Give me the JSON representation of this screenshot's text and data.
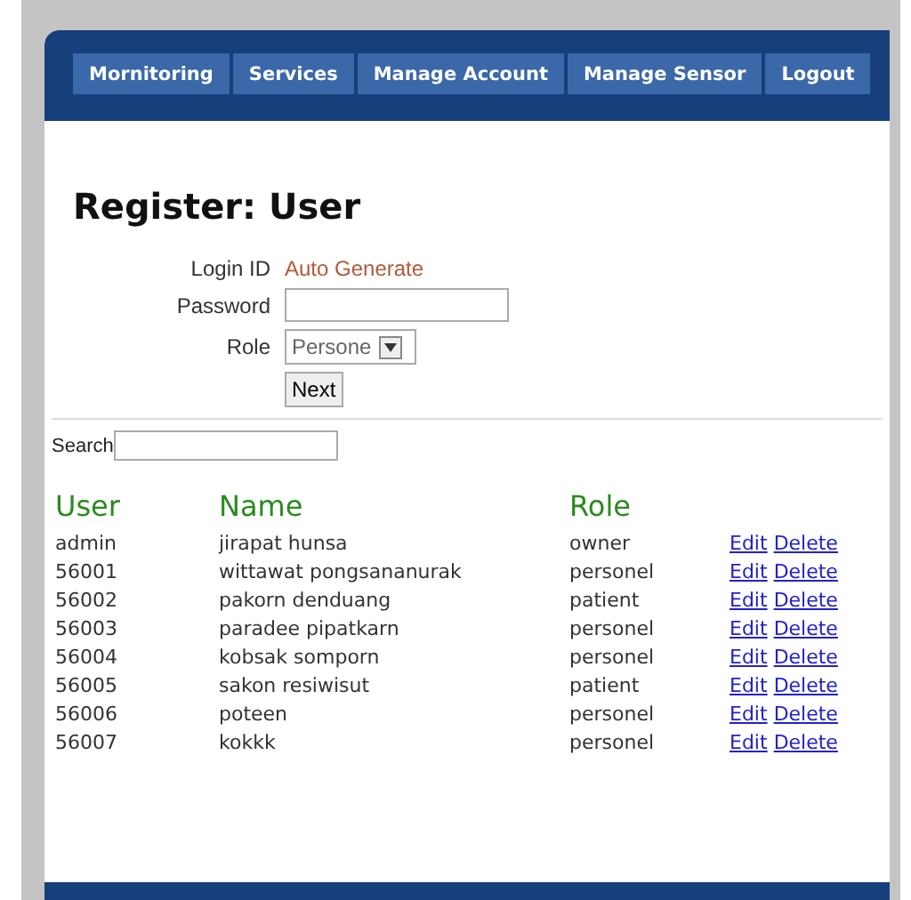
{
  "nav": [
    {
      "label": "Mornitoring"
    },
    {
      "label": "Services"
    },
    {
      "label": "Manage Account"
    },
    {
      "label": "Manage Sensor"
    },
    {
      "label": "Logout"
    }
  ],
  "heading": "Register: User",
  "form": {
    "login_label": "Login ID",
    "login_value": "Auto Generate",
    "password_label": "Password",
    "role_label": "Role",
    "role_value": "Persone",
    "next": "Next"
  },
  "search": {
    "label": "Search"
  },
  "table": {
    "columns": [
      "User",
      "Name",
      "Role"
    ],
    "rows": [
      {
        "user": "admin",
        "name": "jirapat hunsa",
        "role": "owner",
        "edit": "Edit",
        "delete": "Delete"
      },
      {
        "user": "56001",
        "name": "wittawat pongsananurak",
        "role": "personel",
        "edit": "Edit",
        "delete": "Delete"
      },
      {
        "user": "56002",
        "name": "pakorn denduang",
        "role": "patient",
        "edit": "Edit",
        "delete": "Delete"
      },
      {
        "user": "56003",
        "name": "paradee pipatkarn",
        "role": "personel",
        "edit": "Edit",
        "delete": "Delete"
      },
      {
        "user": "56004",
        "name": "kobsak somporn",
        "role": "personel",
        "edit": "Edit",
        "delete": "Delete"
      },
      {
        "user": "56005",
        "name": "sakon resiwisut",
        "role": "patient",
        "edit": "Edit",
        "delete": "Delete"
      },
      {
        "user": "56006",
        "name": "poteen",
        "role": "personel",
        "edit": "Edit",
        "delete": "Delete"
      },
      {
        "user": "56007",
        "name": "kokkk",
        "role": "personel",
        "edit": "Edit",
        "delete": "Delete"
      }
    ]
  }
}
